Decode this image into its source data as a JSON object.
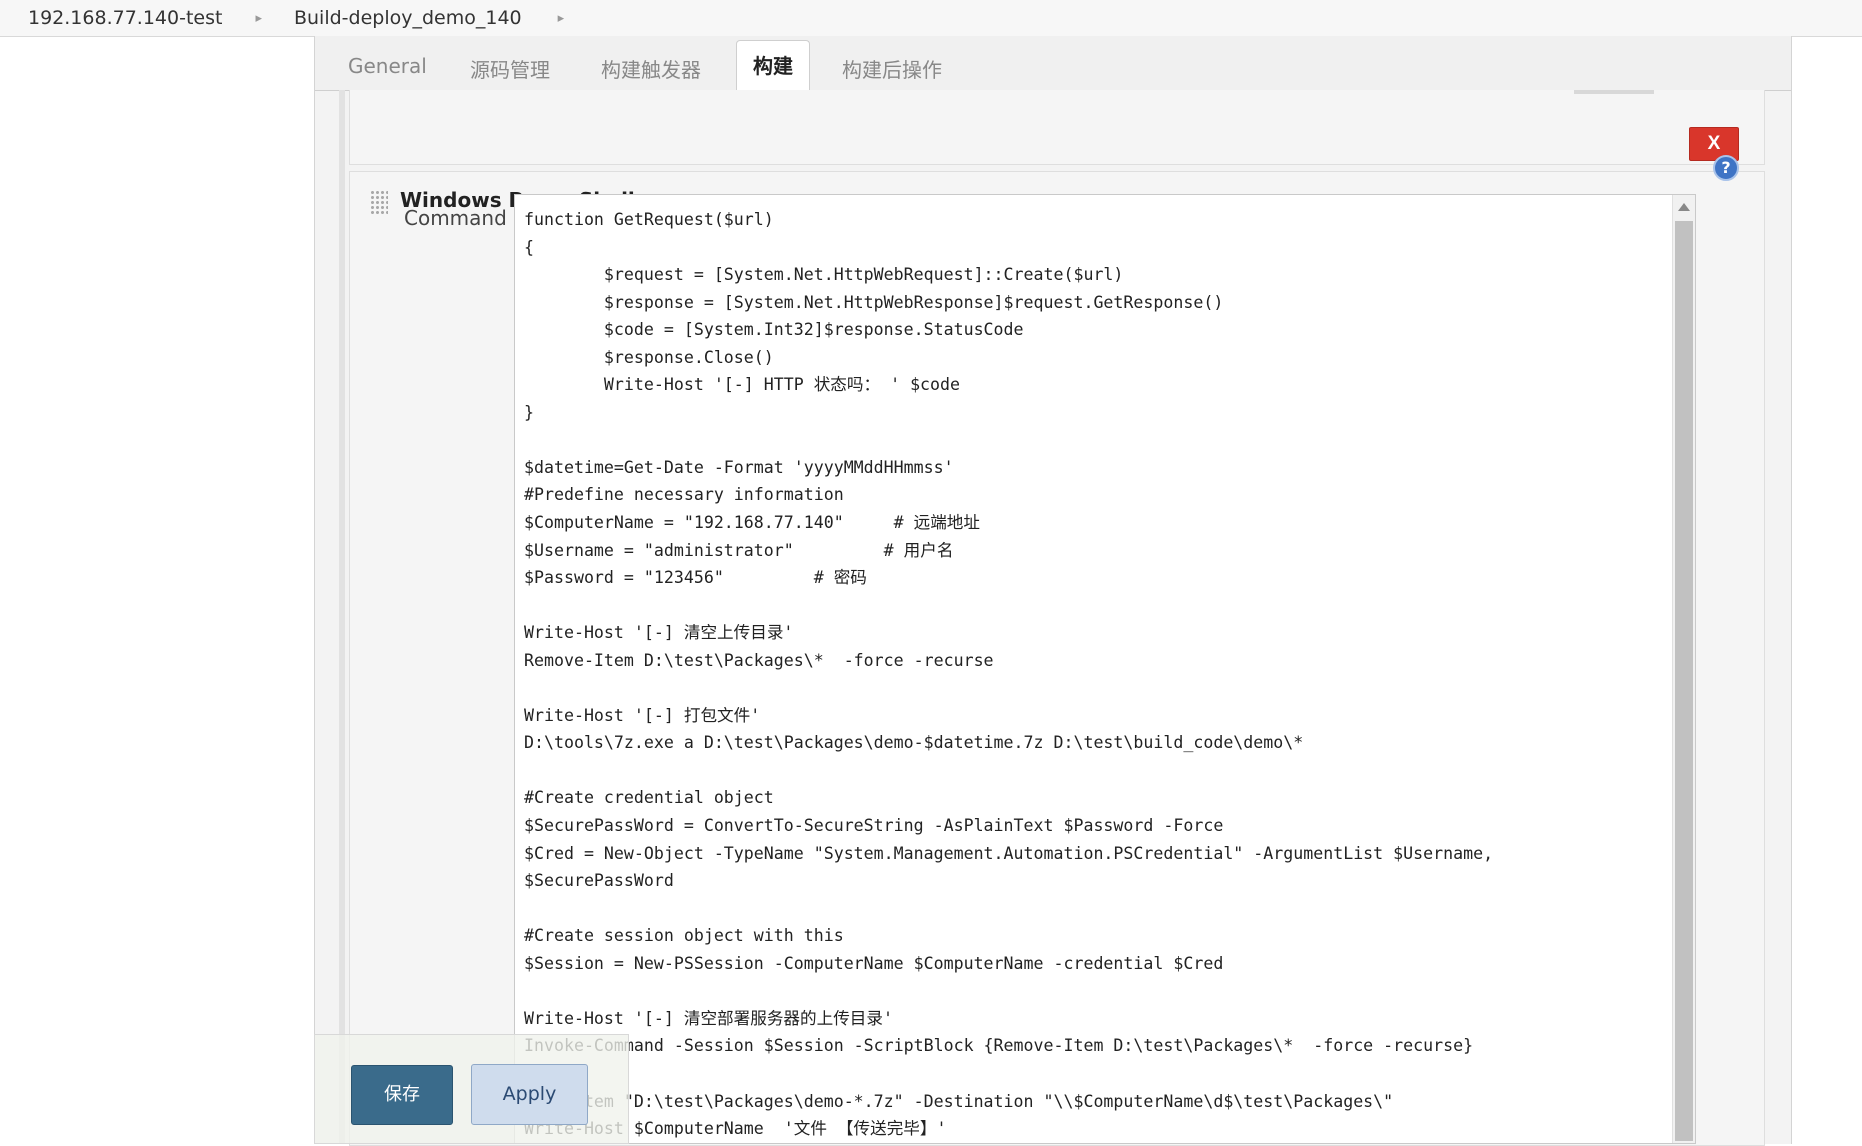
{
  "breadcrumb": {
    "items": [
      "192.168.77.140-test",
      "Build-deploy_demo_140"
    ]
  },
  "tabs": [
    {
      "label": "General"
    },
    {
      "label": "源码管理"
    },
    {
      "label": "构建触发器"
    },
    {
      "label": "构建",
      "active": true
    },
    {
      "label": "构建后操作"
    }
  ],
  "builder": {
    "title": "Windows PowerShell",
    "delete_label": "X",
    "help_label": "?",
    "command_label": "Command"
  },
  "command": {
    "lines": [
      "function GetRequest($url)",
      "{",
      "        $request = [System.Net.HttpWebRequest]::Create($url)",
      "        $response = [System.Net.HttpWebResponse]$request.GetResponse()",
      "        $code = [System.Int32]$response.StatusCode",
      "        $response.Close()",
      "        Write-Host '[-] HTTP 状态吗： ' $code",
      "}",
      "",
      "$datetime=Get-Date -Format 'yyyyMMddHHmmss'",
      "#Predefine necessary information",
      "$ComputerName = \"192.168.77.140\"     # 远端地址",
      "$Username = \"administrator\"         # 用户名",
      "$Password = \"123456\"         # 密码",
      "",
      "Write-Host '[-] 清空上传目录'",
      "Remove-Item D:\\test\\Packages\\*  -force -recurse",
      "",
      "Write-Host '[-] 打包文件'",
      "D:\\tools\\7z.exe a D:\\test\\Packages\\demo-$datetime.7z D:\\test\\build_code\\demo\\*",
      "",
      "#Create credential object",
      "$SecurePassWord = ConvertTo-SecureString -AsPlainText $Password -Force",
      "$Cred = New-Object -TypeName \"System.Management.Automation.PSCredential\" -ArgumentList $Username,",
      "$SecurePassWord",
      "",
      "#Create session object with this",
      "$Session = New-PSSession -ComputerName $ComputerName -credential $Cred",
      "",
      "Write-Host '[-] 清空部署服务器的上传目录'",
      "Invoke-Command -Session $Session -ScriptBlock {Remove-Item D:\\test\\Packages\\*  -force -recurse}",
      "",
      "Copy-Item \"D:\\test\\Packages\\demo-*.7z\" -Destination \"\\\\$ComputerName\\d$\\test\\Packages\\\"",
      "Write-Host $ComputerName  '文件 【传送完毕】'"
    ]
  },
  "actions": {
    "save_label": "保存",
    "apply_label": "Apply"
  }
}
